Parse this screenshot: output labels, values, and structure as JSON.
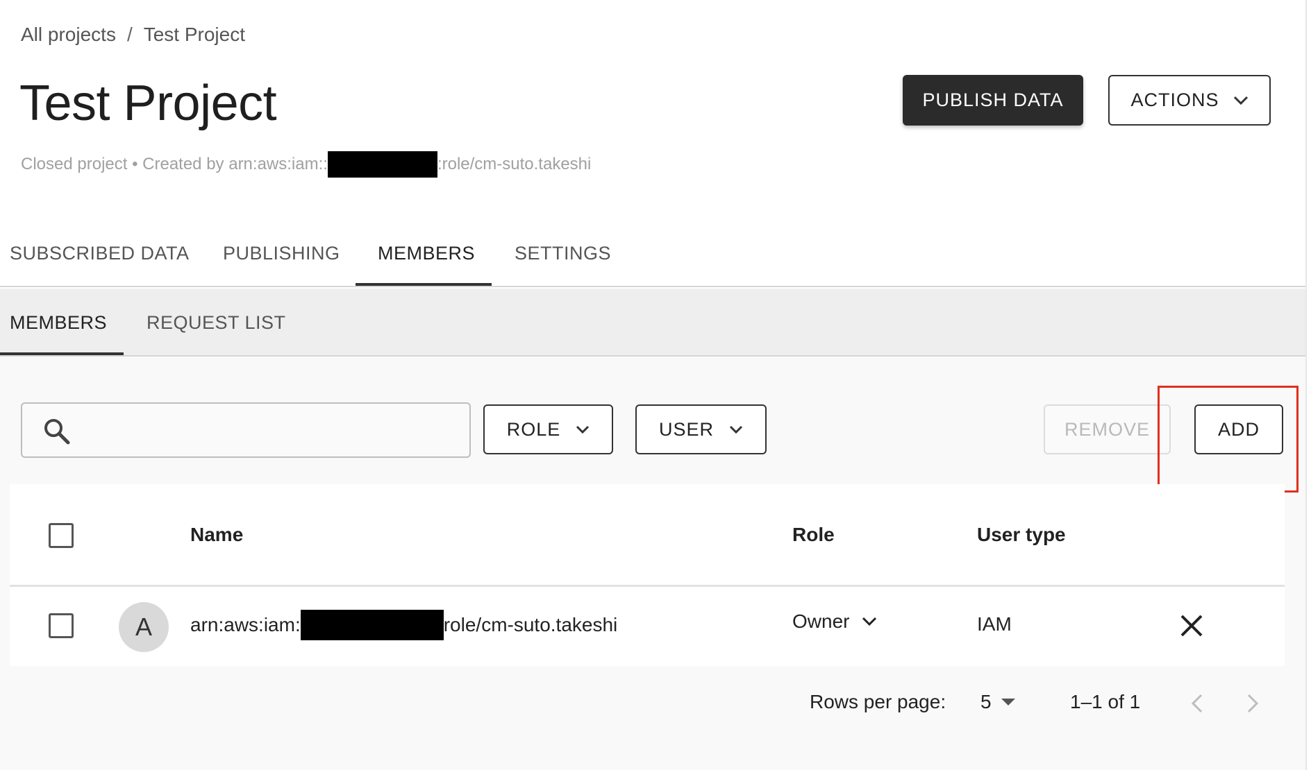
{
  "breadcrumb": {
    "items": [
      "All projects",
      "Test Project"
    ],
    "separator": "/"
  },
  "page": {
    "title": "Test Project",
    "subtitle_prefix": "Closed project • Created by arn:aws:iam::",
    "subtitle_suffix": ":role/cm-suto.takeshi"
  },
  "header_buttons": {
    "publish": "PUBLISH DATA",
    "actions": "ACTIONS"
  },
  "main_tabs": [
    "SUBSCRIBED DATA",
    "PUBLISHING",
    "MEMBERS",
    "SETTINGS"
  ],
  "main_tabs_active": "MEMBERS",
  "sub_tabs": [
    "MEMBERS",
    "REQUEST LIST"
  ],
  "sub_tabs_active": "MEMBERS",
  "toolbar": {
    "search_placeholder": "",
    "role_filter": "ROLE",
    "user_filter": "USER",
    "remove": "REMOVE",
    "add": "ADD"
  },
  "table": {
    "columns": [
      "Name",
      "Role",
      "User type"
    ],
    "rows": [
      {
        "avatar": "A",
        "name_prefix": "arn:aws:iam:",
        "name_suffix": "role/cm-suto.takeshi",
        "role": "Owner",
        "user_type": "IAM"
      }
    ]
  },
  "pagination": {
    "rows_per_page_label": "Rows per page:",
    "rows_per_page": "5",
    "range": "1–1 of 1"
  },
  "colors": {
    "highlight": "#e0301e",
    "primary_button": "#2b2b2b",
    "redaction": "#000000"
  }
}
